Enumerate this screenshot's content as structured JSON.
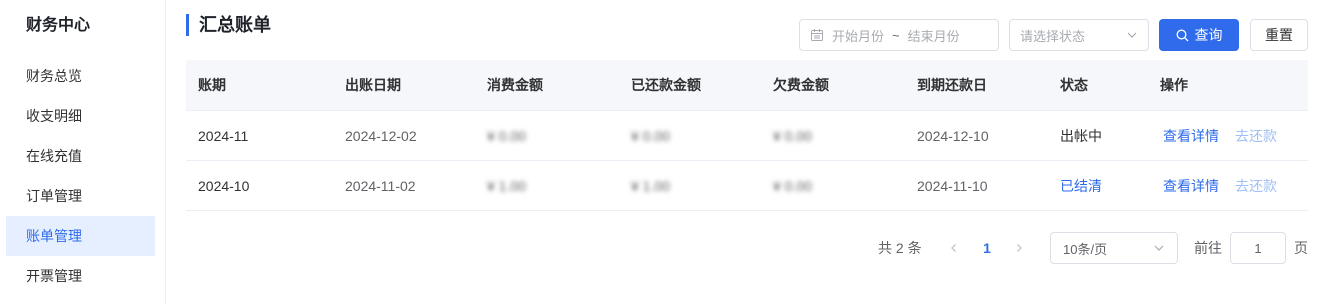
{
  "sidebar": {
    "title": "财务中心",
    "items": [
      {
        "label": "财务总览"
      },
      {
        "label": "收支明细"
      },
      {
        "label": "在线充值"
      },
      {
        "label": "订单管理"
      },
      {
        "label": "账单管理"
      },
      {
        "label": "开票管理"
      }
    ],
    "active_index": 4
  },
  "header": {
    "title": "汇总账单",
    "date_start_placeholder": "开始月份",
    "date_separator": "~",
    "date_end_placeholder": "结束月份",
    "status_placeholder": "请选择状态",
    "search_label": "查询",
    "reset_label": "重置"
  },
  "table": {
    "columns": [
      "账期",
      "出账日期",
      "消费金额",
      "已还款金额",
      "欠费金额",
      "到期还款日",
      "状态",
      "操作"
    ],
    "rows": [
      {
        "period": "2024-11",
        "bill_date": "2024-12-02",
        "consumption": "¥ 0.00",
        "repaid": "¥ 0.00",
        "arrears": "¥ 0.00",
        "due_date": "2024-12-10",
        "status": "出帐中",
        "action_detail": "查看详情",
        "action_repay": "去还款"
      },
      {
        "period": "2024-10",
        "bill_date": "2024-11-02",
        "consumption": "¥ 1.00",
        "repaid": "¥ 1.00",
        "arrears": "¥ 0.00",
        "due_date": "2024-11-10",
        "status": "已结清",
        "action_detail": "查看详情",
        "action_repay": "去还款"
      }
    ]
  },
  "pagination": {
    "total_text": "共 2 条",
    "current_page": "1",
    "page_size": "10条/页",
    "goto_label": "前往",
    "goto_value": "1",
    "page_unit": "页"
  },
  "colors": {
    "primary": "#2f6bea",
    "active_bg": "#e6efff",
    "disabled_link": "#a0bff5"
  }
}
